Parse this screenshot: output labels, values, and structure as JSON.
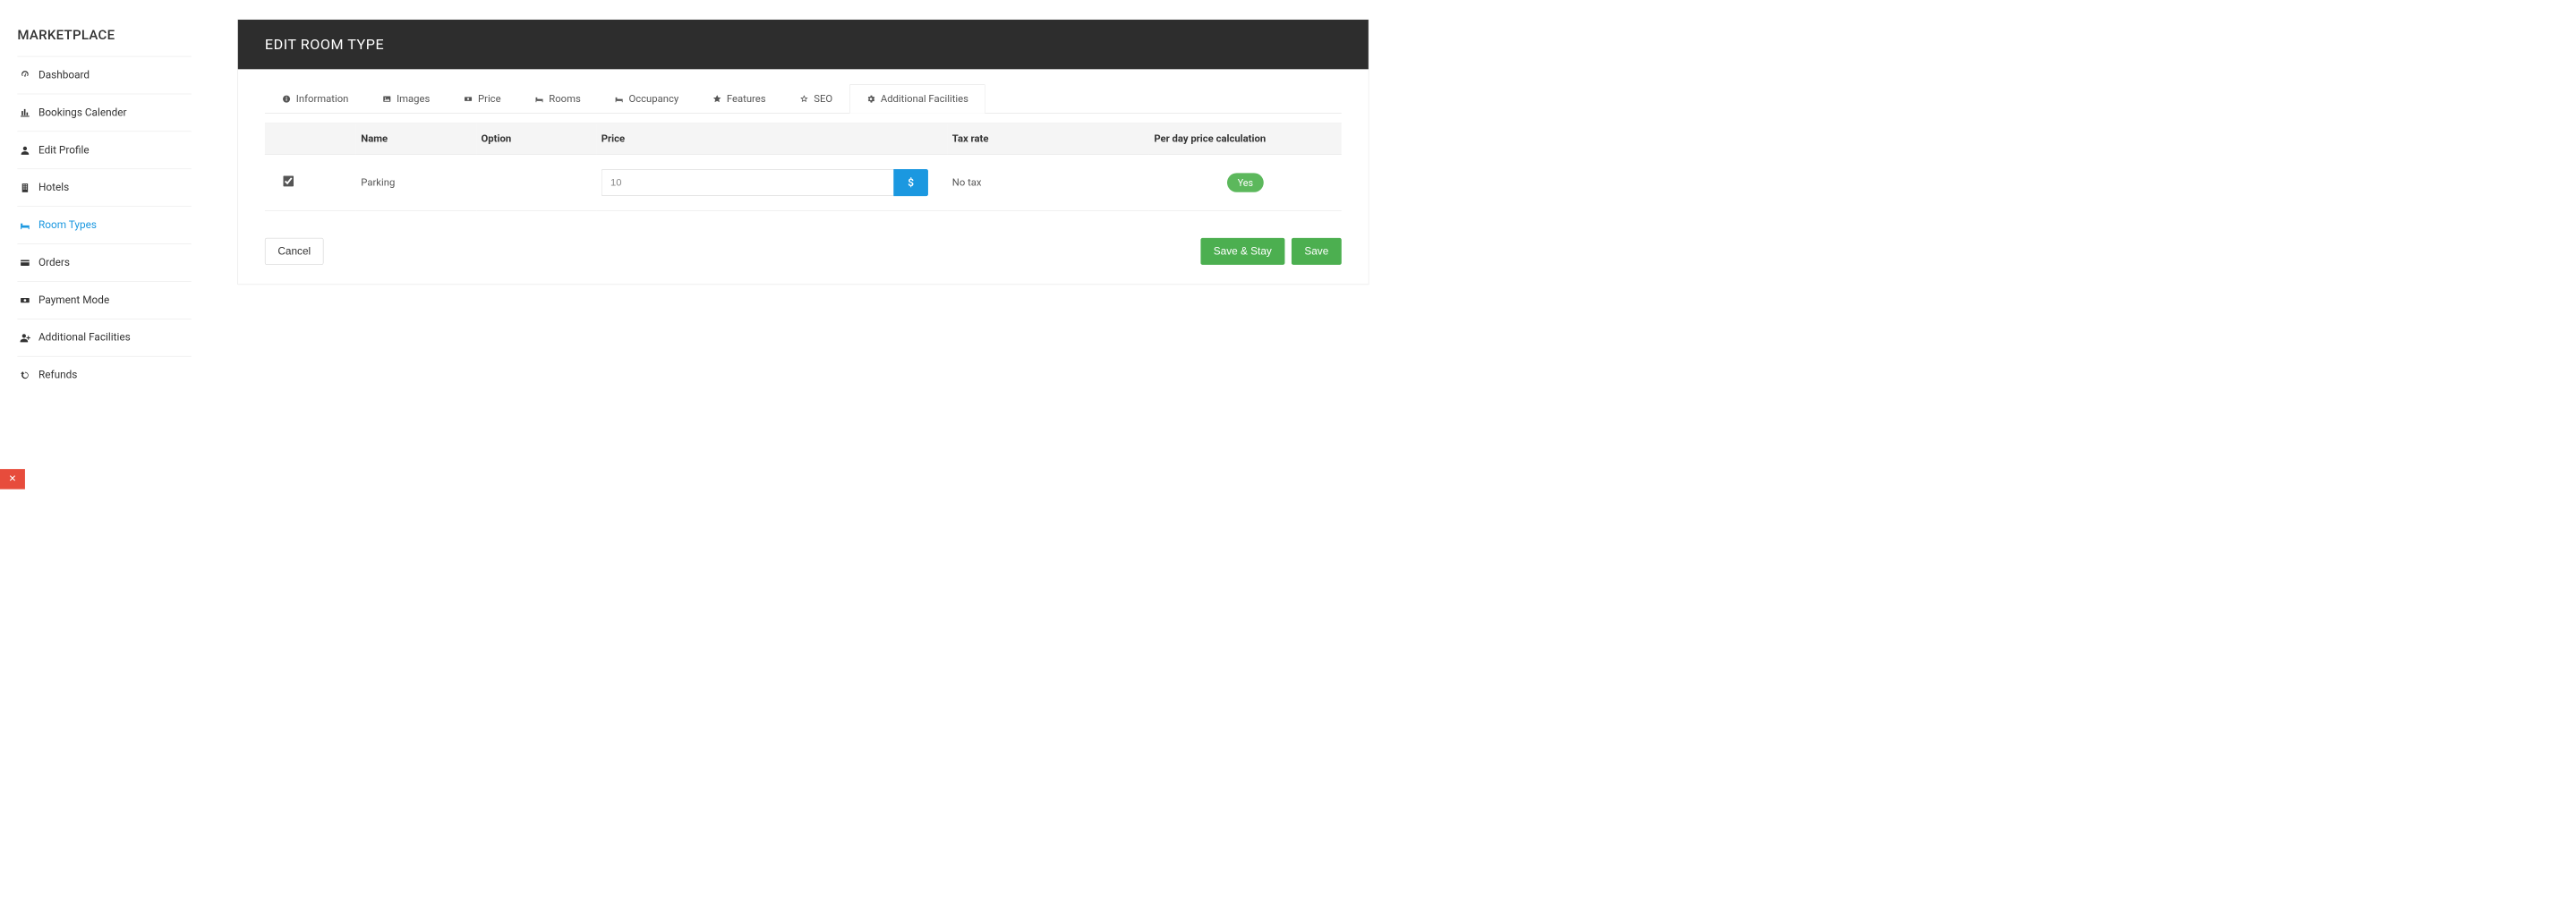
{
  "sidebar": {
    "heading": "MARKETPLACE",
    "items": [
      {
        "label": "Dashboard",
        "icon": "dashboard"
      },
      {
        "label": "Bookings Calender",
        "icon": "barchart"
      },
      {
        "label": "Edit Profile",
        "icon": "user"
      },
      {
        "label": "Hotels",
        "icon": "building"
      },
      {
        "label": "Room Types",
        "icon": "bed",
        "active": true
      },
      {
        "label": "Orders",
        "icon": "credit-card"
      },
      {
        "label": "Payment Mode",
        "icon": "cash"
      },
      {
        "label": "Additional Facilities",
        "icon": "user-plus"
      },
      {
        "label": "Refunds",
        "icon": "refresh"
      }
    ]
  },
  "header": {
    "title": "EDIT ROOM TYPE"
  },
  "tabs": [
    {
      "label": "Information",
      "icon": "info"
    },
    {
      "label": "Images",
      "icon": "image"
    },
    {
      "label": "Price",
      "icon": "cash"
    },
    {
      "label": "Rooms",
      "icon": "bed"
    },
    {
      "label": "Occupancy",
      "icon": "bed"
    },
    {
      "label": "Features",
      "icon": "star-filled"
    },
    {
      "label": "SEO",
      "icon": "star-outline"
    },
    {
      "label": "Additional Facilities",
      "icon": "gear",
      "active": true
    }
  ],
  "table": {
    "headers": {
      "check": "",
      "name": "Name",
      "option": "Option",
      "price": "Price",
      "tax": "Tax rate",
      "perday": "Per day price calculation"
    },
    "rows": [
      {
        "checked": true,
        "name": "Parking",
        "option": "",
        "price": "10",
        "currency": "$",
        "tax": "No tax",
        "perday": "Yes"
      }
    ]
  },
  "actions": {
    "cancel": "Cancel",
    "saveStay": "Save & Stay",
    "save": "Save"
  }
}
